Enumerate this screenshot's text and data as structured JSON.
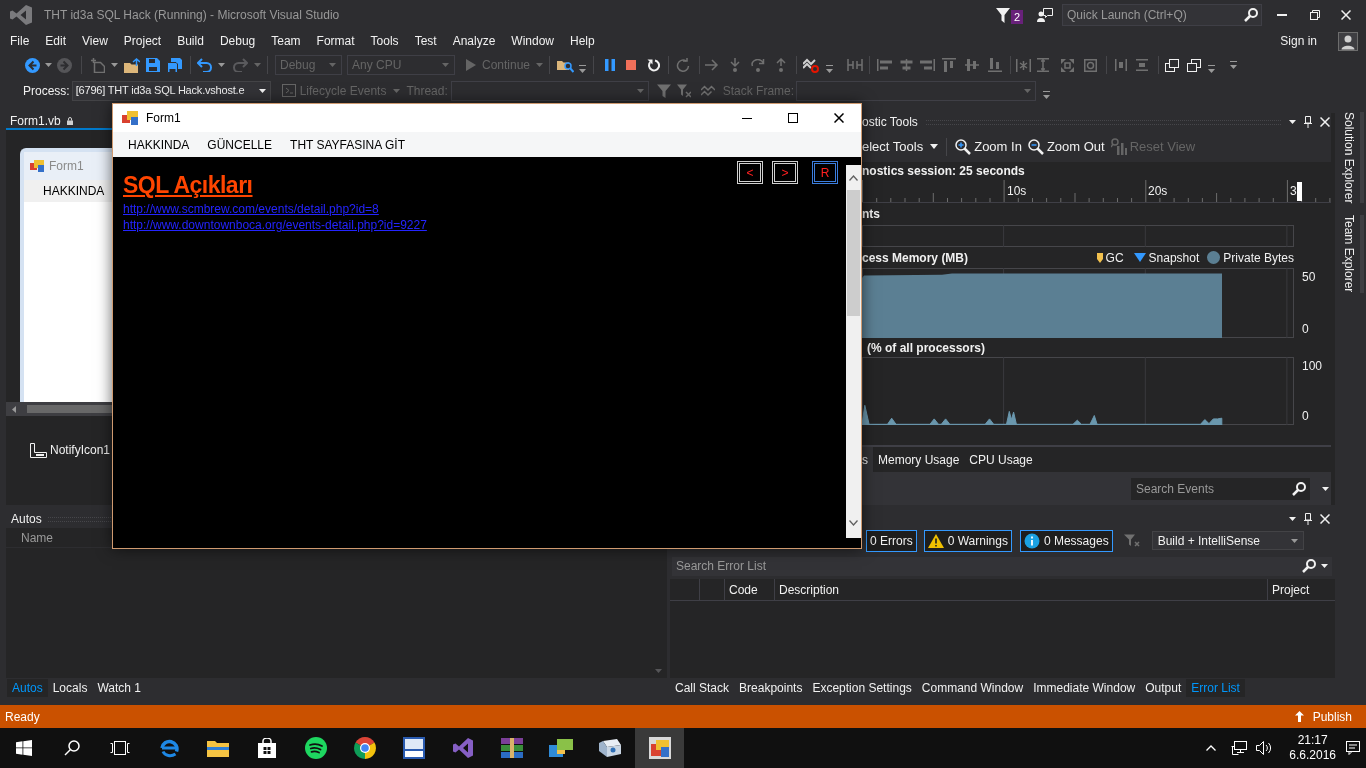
{
  "window": {
    "title": "THT id3a SQL Hack (Running) - Microsoft Visual Studio",
    "notification_count": "2",
    "quick_launch": {
      "placeholder": "Quick Launch (Ctrl+Q)"
    }
  },
  "menu": [
    "File",
    "Edit",
    "View",
    "Project",
    "Build",
    "Debug",
    "Team",
    "Format",
    "Tools",
    "Test",
    "Analyze",
    "Window",
    "Help"
  ],
  "account": {
    "sign_in": "Sign in"
  },
  "standard_toolbar": {
    "configuration": {
      "value": "Debug",
      "disabled": true
    },
    "platform": {
      "value": "Any CPU",
      "disabled": true
    },
    "continue": {
      "label": "Continue",
      "disabled": true
    }
  },
  "debug_location_toolbar": {
    "process": {
      "label": "Process:",
      "value": "[6796] THT id3a SQL Hack.vshost.e"
    },
    "lifecycle_events": {
      "label": "Lifecycle Events",
      "disabled": true
    },
    "thread": {
      "label": "Thread:",
      "disabled": true
    },
    "stack_frame": {
      "label": "Stack Frame:",
      "disabled": true
    }
  },
  "designer": {
    "tab": {
      "label": "Form1.vb",
      "selected": true
    },
    "form_preview": {
      "title": "Form1",
      "menu": [
        "HAKKINDA"
      ]
    },
    "components": [
      "NotifyIcon1"
    ]
  },
  "app_window": {
    "title": "Form1",
    "menu": [
      "HAKKINDA",
      "GÜNCELLE",
      "THT SAYFASINA GİT"
    ],
    "heading": "SQL Açıkları",
    "links": [
      "http://www.scmbrew.com/events/detail.php?id=8",
      "http://www.downtownboca.org/events-detail.php?id=9227"
    ],
    "nav_buttons": [
      {
        "label": "<",
        "focused": false
      },
      {
        "label": ">",
        "focused": false
      },
      {
        "label": "R",
        "focused": true
      }
    ]
  },
  "diagnostic_tools": {
    "title": "ostic Tools",
    "toolbar": [
      {
        "kind": "select_tools",
        "label": "elect Tools",
        "disabled": false
      },
      {
        "kind": "zoom_in",
        "label": "Zoom In",
        "disabled": false
      },
      {
        "kind": "zoom_out",
        "label": "Zoom Out",
        "disabled": false
      },
      {
        "kind": "reset_view",
        "label": "Reset View",
        "disabled": true
      }
    ],
    "session": "nostics session: 25 seconds",
    "timeline": [
      "10s",
      "20s",
      "3"
    ],
    "events": {
      "title": "nts"
    },
    "memory": {
      "title": "cess Memory (MB)",
      "legend": [
        {
          "kind": "gc",
          "label": "GC"
        },
        {
          "kind": "snapshot",
          "label": "Snapshot"
        },
        {
          "kind": "private_bytes",
          "label": "Private Bytes"
        }
      ],
      "axis_labels": [
        "50",
        "0"
      ]
    },
    "cpu": {
      "title": "(% of all processors)",
      "axis_labels": [
        "100",
        "0"
      ]
    },
    "tabs": [
      {
        "label": "s",
        "selected": true
      },
      {
        "label": "Memory Usage",
        "selected": false
      },
      {
        "label": "CPU Usage",
        "selected": false
      }
    ],
    "search": {
      "placeholder": "Search Events"
    }
  },
  "autos": {
    "title": "Autos",
    "columns": [
      "Name"
    ],
    "tabs": [
      {
        "label": "Autos",
        "selected": true
      },
      {
        "label": "Locals",
        "selected": false
      },
      {
        "label": "Watch 1",
        "selected": false
      }
    ]
  },
  "error_list": {
    "filters": [
      {
        "kind": "error",
        "label": "0 Errors",
        "on": true
      },
      {
        "kind": "warning",
        "label": "0 Warnings",
        "on": true
      },
      {
        "kind": "message",
        "label": "0 Messages",
        "on": true
      }
    ],
    "scope": {
      "value": "Build + IntelliSense"
    },
    "search": {
      "placeholder": "Search Error List"
    },
    "columns": [
      "Code",
      "Description",
      "Project"
    ],
    "tabs": [
      {
        "label": "Call Stack",
        "selected": false
      },
      {
        "label": "Breakpoints",
        "selected": false
      },
      {
        "label": "Exception Settings",
        "selected": false
      },
      {
        "label": "Command Window",
        "selected": false
      },
      {
        "label": "Immediate Window",
        "selected": false
      },
      {
        "label": "Output",
        "selected": false
      },
      {
        "label": "Error List",
        "selected": true
      }
    ]
  },
  "side_tabs": [
    "Solution Explorer",
    "Team Explorer"
  ],
  "status_bar": {
    "text": "Ready",
    "publish": "Publish"
  },
  "taskbar": {
    "buttons": [
      {
        "kind": "start"
      },
      {
        "kind": "search"
      },
      {
        "kind": "task_view"
      }
    ],
    "apps": [
      {
        "kind": "browser",
        "active": false
      },
      {
        "kind": "folder",
        "active": false
      },
      {
        "kind": "bag",
        "active": false
      },
      {
        "kind": "disc_waves",
        "active": false
      },
      {
        "kind": "wheel",
        "active": false
      },
      {
        "kind": "tile",
        "active": false
      },
      {
        "kind": "ribbon",
        "active": false
      },
      {
        "kind": "books",
        "active": false
      },
      {
        "kind": "windows_pair",
        "active": false
      },
      {
        "kind": "box",
        "active": false
      },
      {
        "kind": "app_window",
        "active": true
      }
    ],
    "clock": {
      "time": "21:17",
      "date": "6.6.2016"
    }
  }
}
